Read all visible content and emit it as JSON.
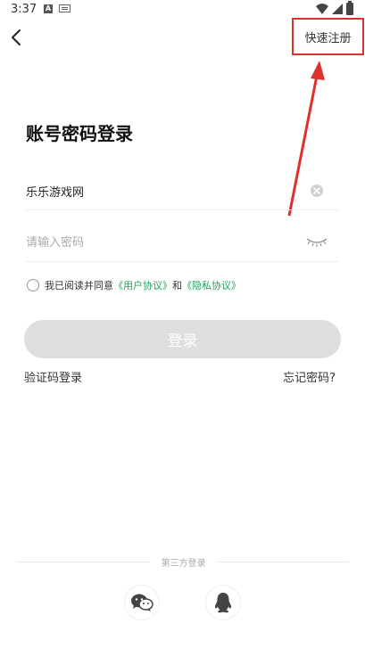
{
  "status_bar": {
    "time": "3:37",
    "notif_letter": "A"
  },
  "nav": {
    "register_label": "快速注册"
  },
  "title": "账号密码登录",
  "form": {
    "username_value": "乐乐游戏网",
    "password_placeholder": "请输入密码"
  },
  "agreement": {
    "prefix": "我已阅读并同意",
    "user_agreement": "《用户协议》",
    "and": "和",
    "privacy_agreement": "《隐私协议》"
  },
  "login_button": "登录",
  "sms_login": "验证码登录",
  "forgot_password": "忘记密码?",
  "third_party": {
    "label": "第三方登录"
  },
  "colors": {
    "annotation_red": "#e0302c",
    "link_green": "#20a35a",
    "button_disabled": "#dedede"
  }
}
